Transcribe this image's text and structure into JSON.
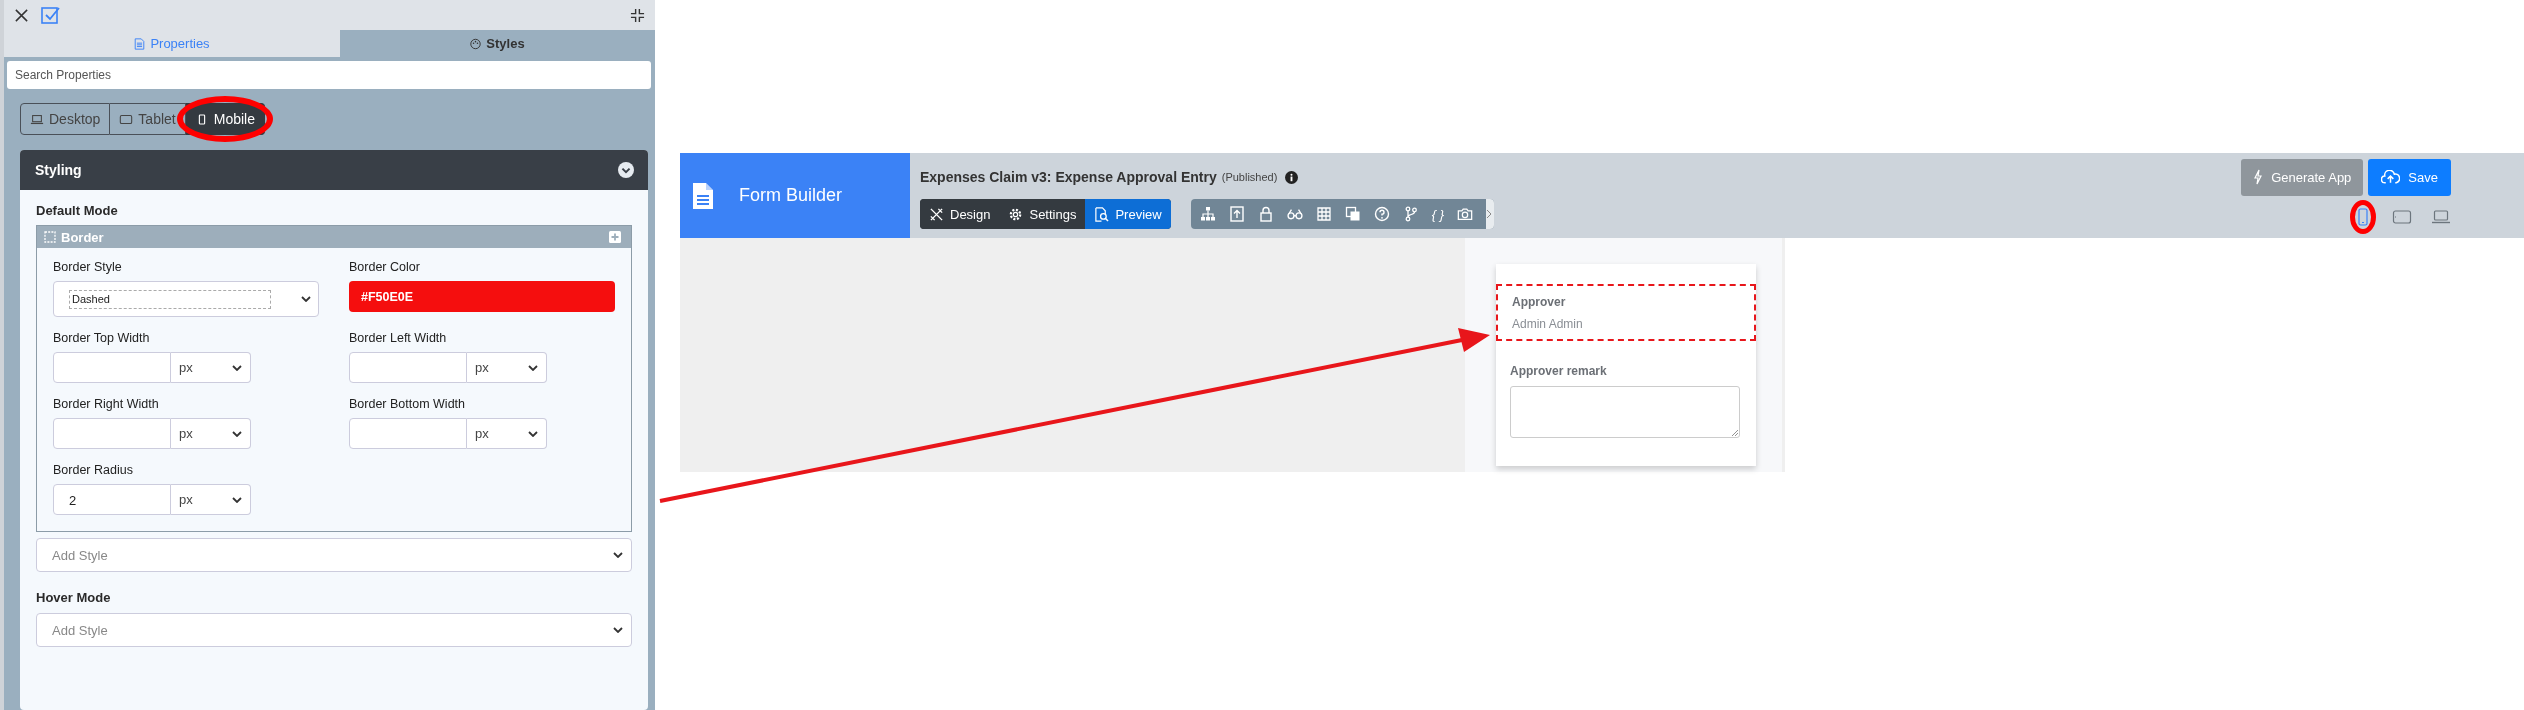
{
  "panel": {
    "tabs": [
      {
        "label": "Properties",
        "selected": false,
        "kind": "properties"
      },
      {
        "label": "Styles",
        "selected": true,
        "kind": "styles"
      }
    ],
    "search": {
      "placeholder": "Search Properties"
    },
    "devices": [
      {
        "label": "Desktop",
        "kind": "desktop",
        "selected": false,
        "highlighted": false
      },
      {
        "label": "Tablet",
        "kind": "tablet",
        "selected": false,
        "highlighted": false
      },
      {
        "label": "Mobile",
        "kind": "mobile",
        "selected": true,
        "highlighted": true
      }
    ],
    "styling": {
      "title": "Styling",
      "expanded": true,
      "default_mode": "Default Mode",
      "border": {
        "title": "Border",
        "fields": [
          {
            "label": "Border Style",
            "kind": "select",
            "value": "Dashed"
          },
          {
            "label": "Border Color",
            "kind": "color",
            "value": "#F50E0E",
            "color": "#f50e0e"
          },
          {
            "label": "Border Top Width",
            "kind": "unit",
            "unit": "px"
          },
          {
            "label": "Border Left Width",
            "kind": "unit",
            "unit": "px"
          },
          {
            "label": "Border Right Width",
            "kind": "unit",
            "unit": "px"
          },
          {
            "label": "Border Bottom Width",
            "kind": "unit",
            "unit": "px"
          },
          {
            "label": "Border Radius",
            "kind": "unit",
            "value": "2",
            "unit": "px"
          }
        ]
      },
      "add_style": {
        "placeholder": "Add Style"
      },
      "hover_mode": {
        "label": "Hover Mode",
        "placeholder": "Add Style"
      }
    }
  },
  "builder": {
    "brand": "Form Builder",
    "title": "Expenses Claim v3: Expense Approval Entry",
    "status": "(Published)",
    "modes": [
      {
        "label": "Design",
        "kind": "design",
        "selected": false
      },
      {
        "label": "Settings",
        "kind": "settings",
        "selected": false
      },
      {
        "label": "Preview",
        "kind": "preview",
        "selected": true
      }
    ],
    "braces": "{ }",
    "buttons": [
      {
        "label": "Generate App",
        "kind": "generate"
      },
      {
        "label": "Save",
        "kind": "save"
      }
    ],
    "views": [
      {
        "kind": "mobile",
        "selected": true,
        "highlighted": true
      },
      {
        "kind": "tablet",
        "selected": false,
        "highlighted": false
      },
      {
        "kind": "laptop",
        "selected": false,
        "highlighted": false
      }
    ],
    "form": [
      {
        "label": "Approver",
        "kind": "text",
        "value": "Admin Admin",
        "outlined": true
      },
      {
        "label": "Approver remark",
        "kind": "textarea",
        "outlined": false
      }
    ]
  },
  "annotations": {
    "arrow": true
  }
}
